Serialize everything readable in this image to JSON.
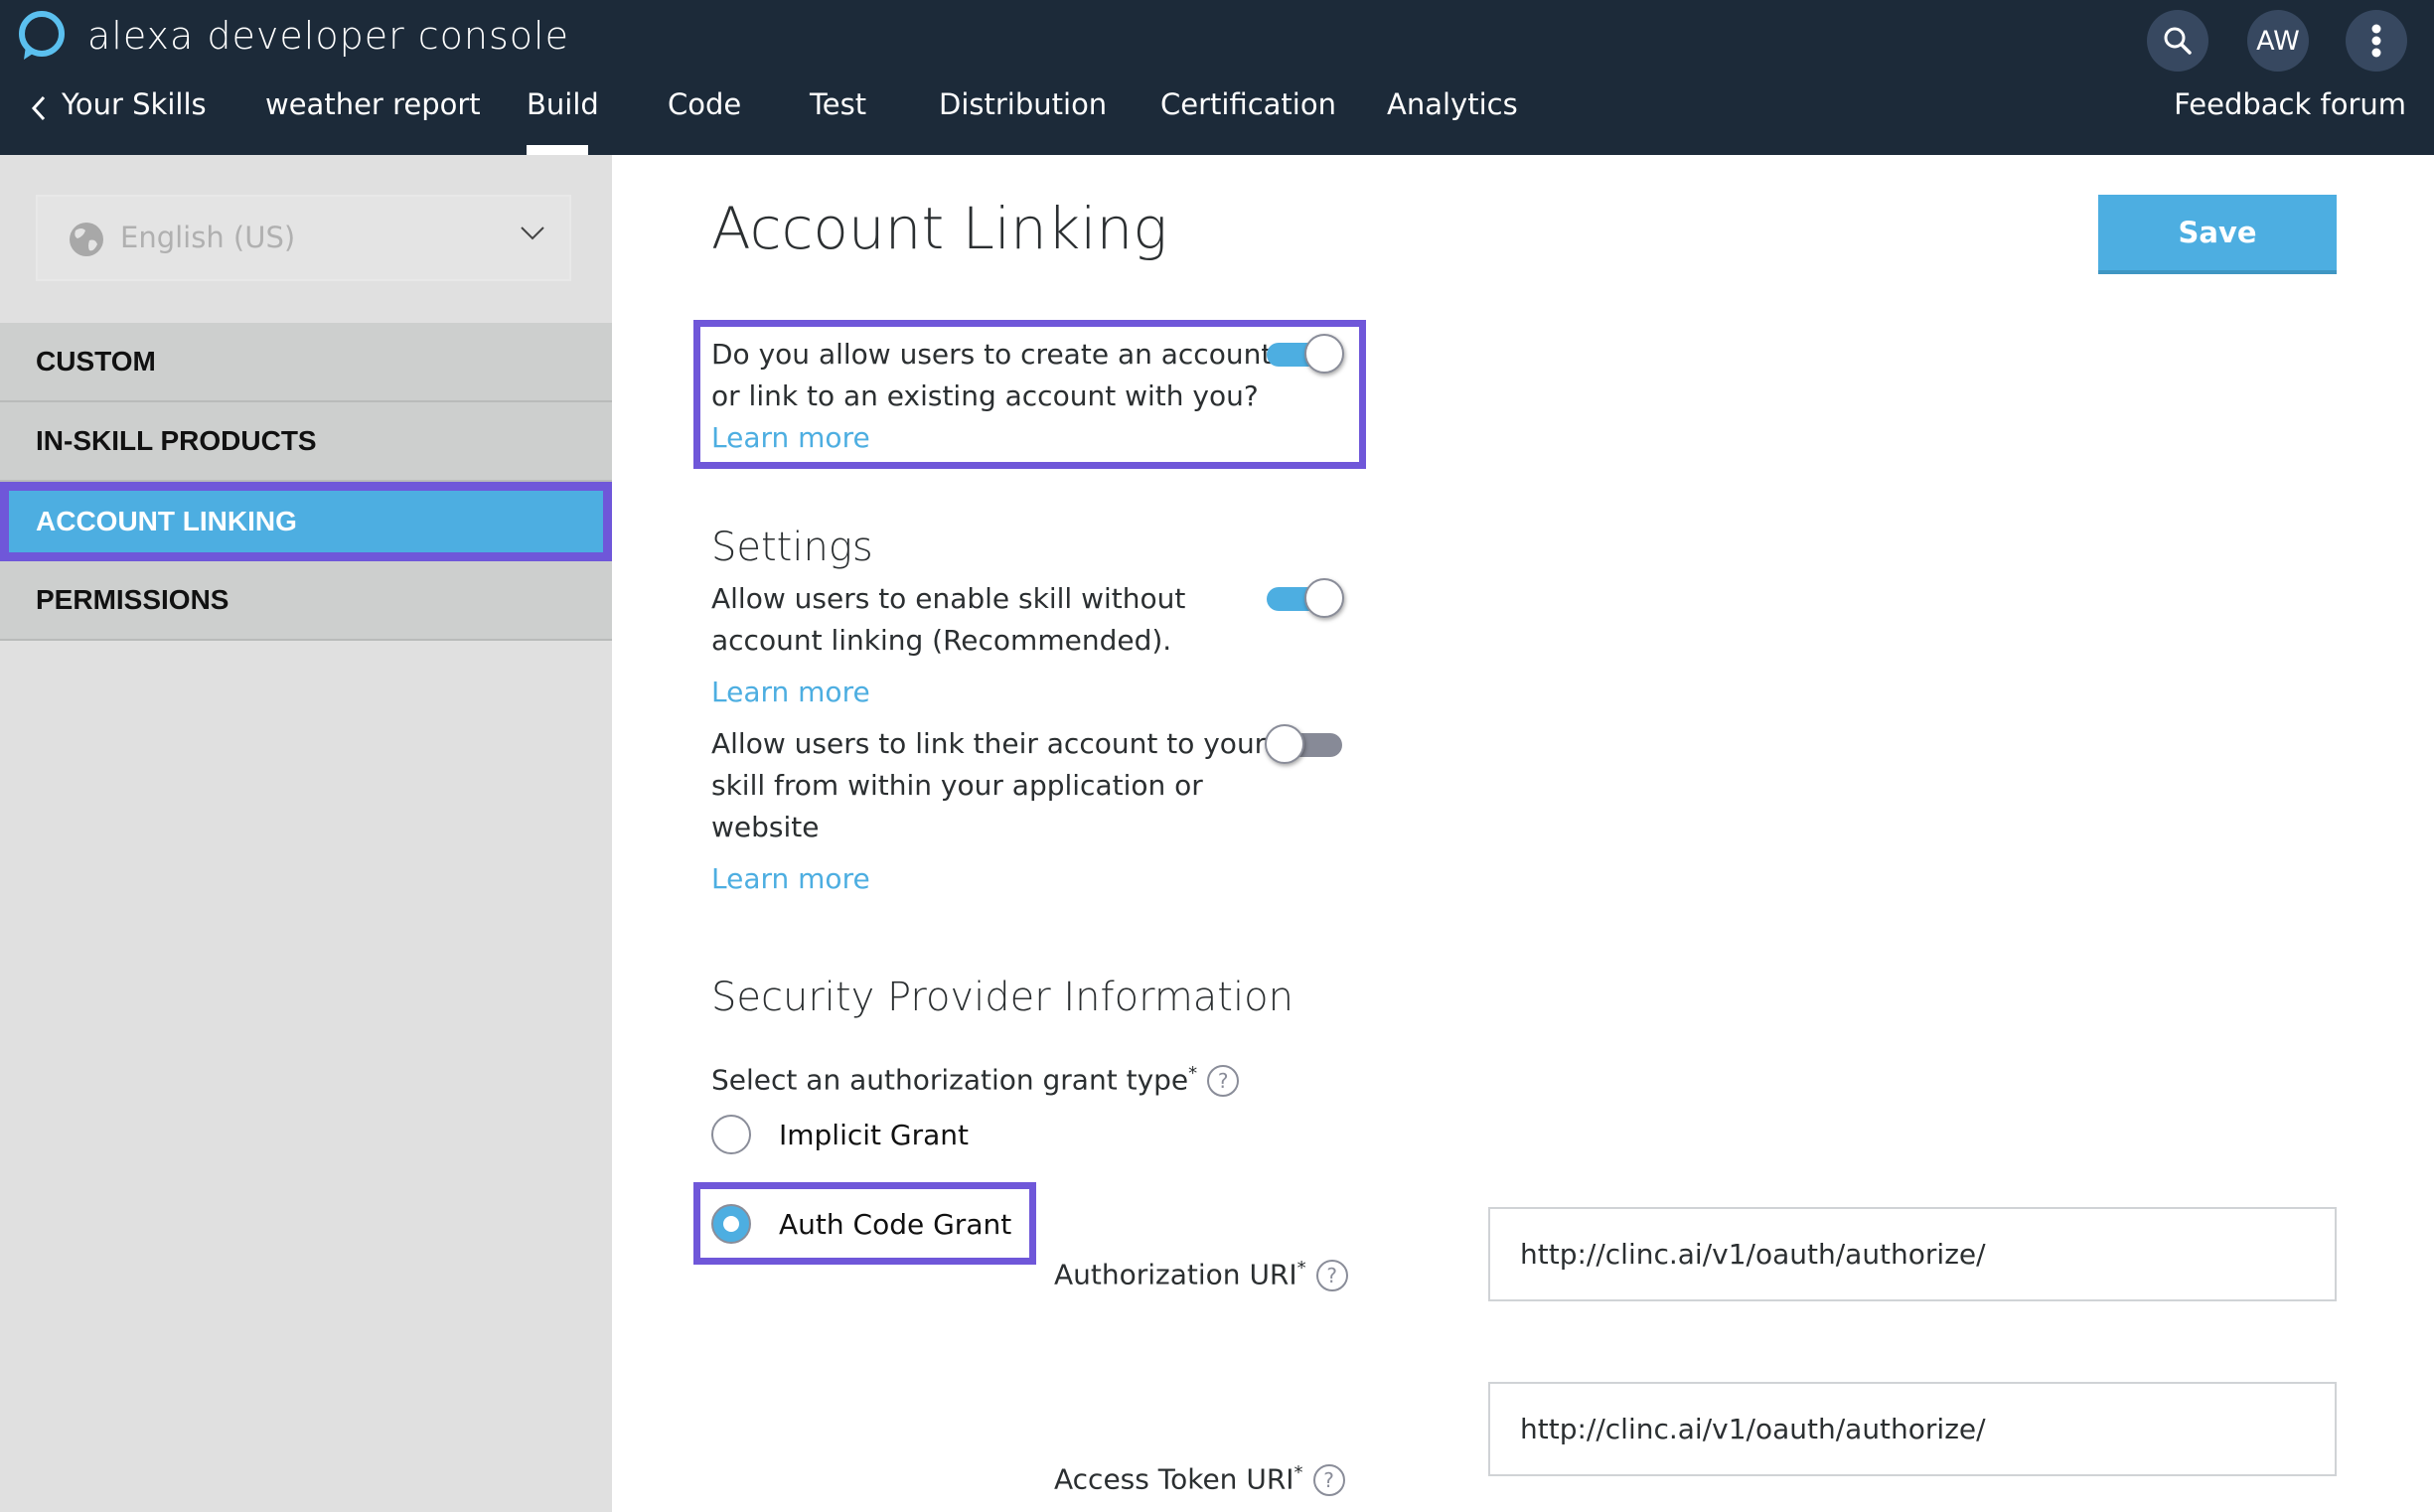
{
  "header": {
    "app_title": "alexa developer console",
    "back_label": "Your Skills",
    "skill_name": "weather report",
    "tabs": [
      {
        "label": "Build",
        "active": true
      },
      {
        "label": "Code",
        "active": false
      },
      {
        "label": "Test",
        "active": false
      },
      {
        "label": "Distribution",
        "active": false
      },
      {
        "label": "Certification",
        "active": false
      },
      {
        "label": "Analytics",
        "active": false
      }
    ],
    "search_icon": "search-icon",
    "avatar_initials": "AW",
    "more_icon": "more-vertical-icon",
    "feedback_label": "Feedback forum"
  },
  "sidebar": {
    "locale": {
      "value": "English (US)",
      "icon": "globe-icon"
    },
    "items": [
      {
        "label": "CUSTOM",
        "active": false
      },
      {
        "label": "IN-SKILL PRODUCTS",
        "active": false
      },
      {
        "label": "ACCOUNT LINKING",
        "active": true
      },
      {
        "label": "PERMISSIONS",
        "active": false
      }
    ]
  },
  "main": {
    "title": "Account Linking",
    "save_label": "Save",
    "allow_account": {
      "question_line1": "Do you allow users to create an account",
      "question_line2": "or link to an existing account with you?",
      "learn_more": "Learn more",
      "enabled": true
    },
    "settings": {
      "heading": "Settings",
      "options": [
        {
          "line1": "Allow users to enable skill without",
          "line2": "account linking (Recommended).",
          "learn_more": "Learn more",
          "enabled": true
        },
        {
          "line1": "Allow users to link their account to your",
          "line2": "skill from within your application or",
          "line3": "website",
          "learn_more": "Learn more",
          "enabled": false
        }
      ]
    },
    "security": {
      "heading": "Security Provider Information",
      "grant_type_label": "Select an authorization grant type",
      "required_mark": "*",
      "help_glyph": "?",
      "grant_options": [
        {
          "label": "Implicit Grant",
          "selected": false
        },
        {
          "label": "Auth Code Grant",
          "selected": true
        }
      ],
      "authorization_uri": {
        "label": "Authorization URI",
        "value": "http://clinc.ai/v1/oauth/authorize/"
      },
      "access_token_uri": {
        "label": "Access Token URI",
        "value": "http://clinc.ai/v1/oauth/authorize/"
      }
    }
  },
  "colors": {
    "header_bg": "#1c2a39",
    "accent": "#4daee1",
    "highlight": "#6f57d9",
    "sidebar_bg": "#e0e0e0"
  }
}
